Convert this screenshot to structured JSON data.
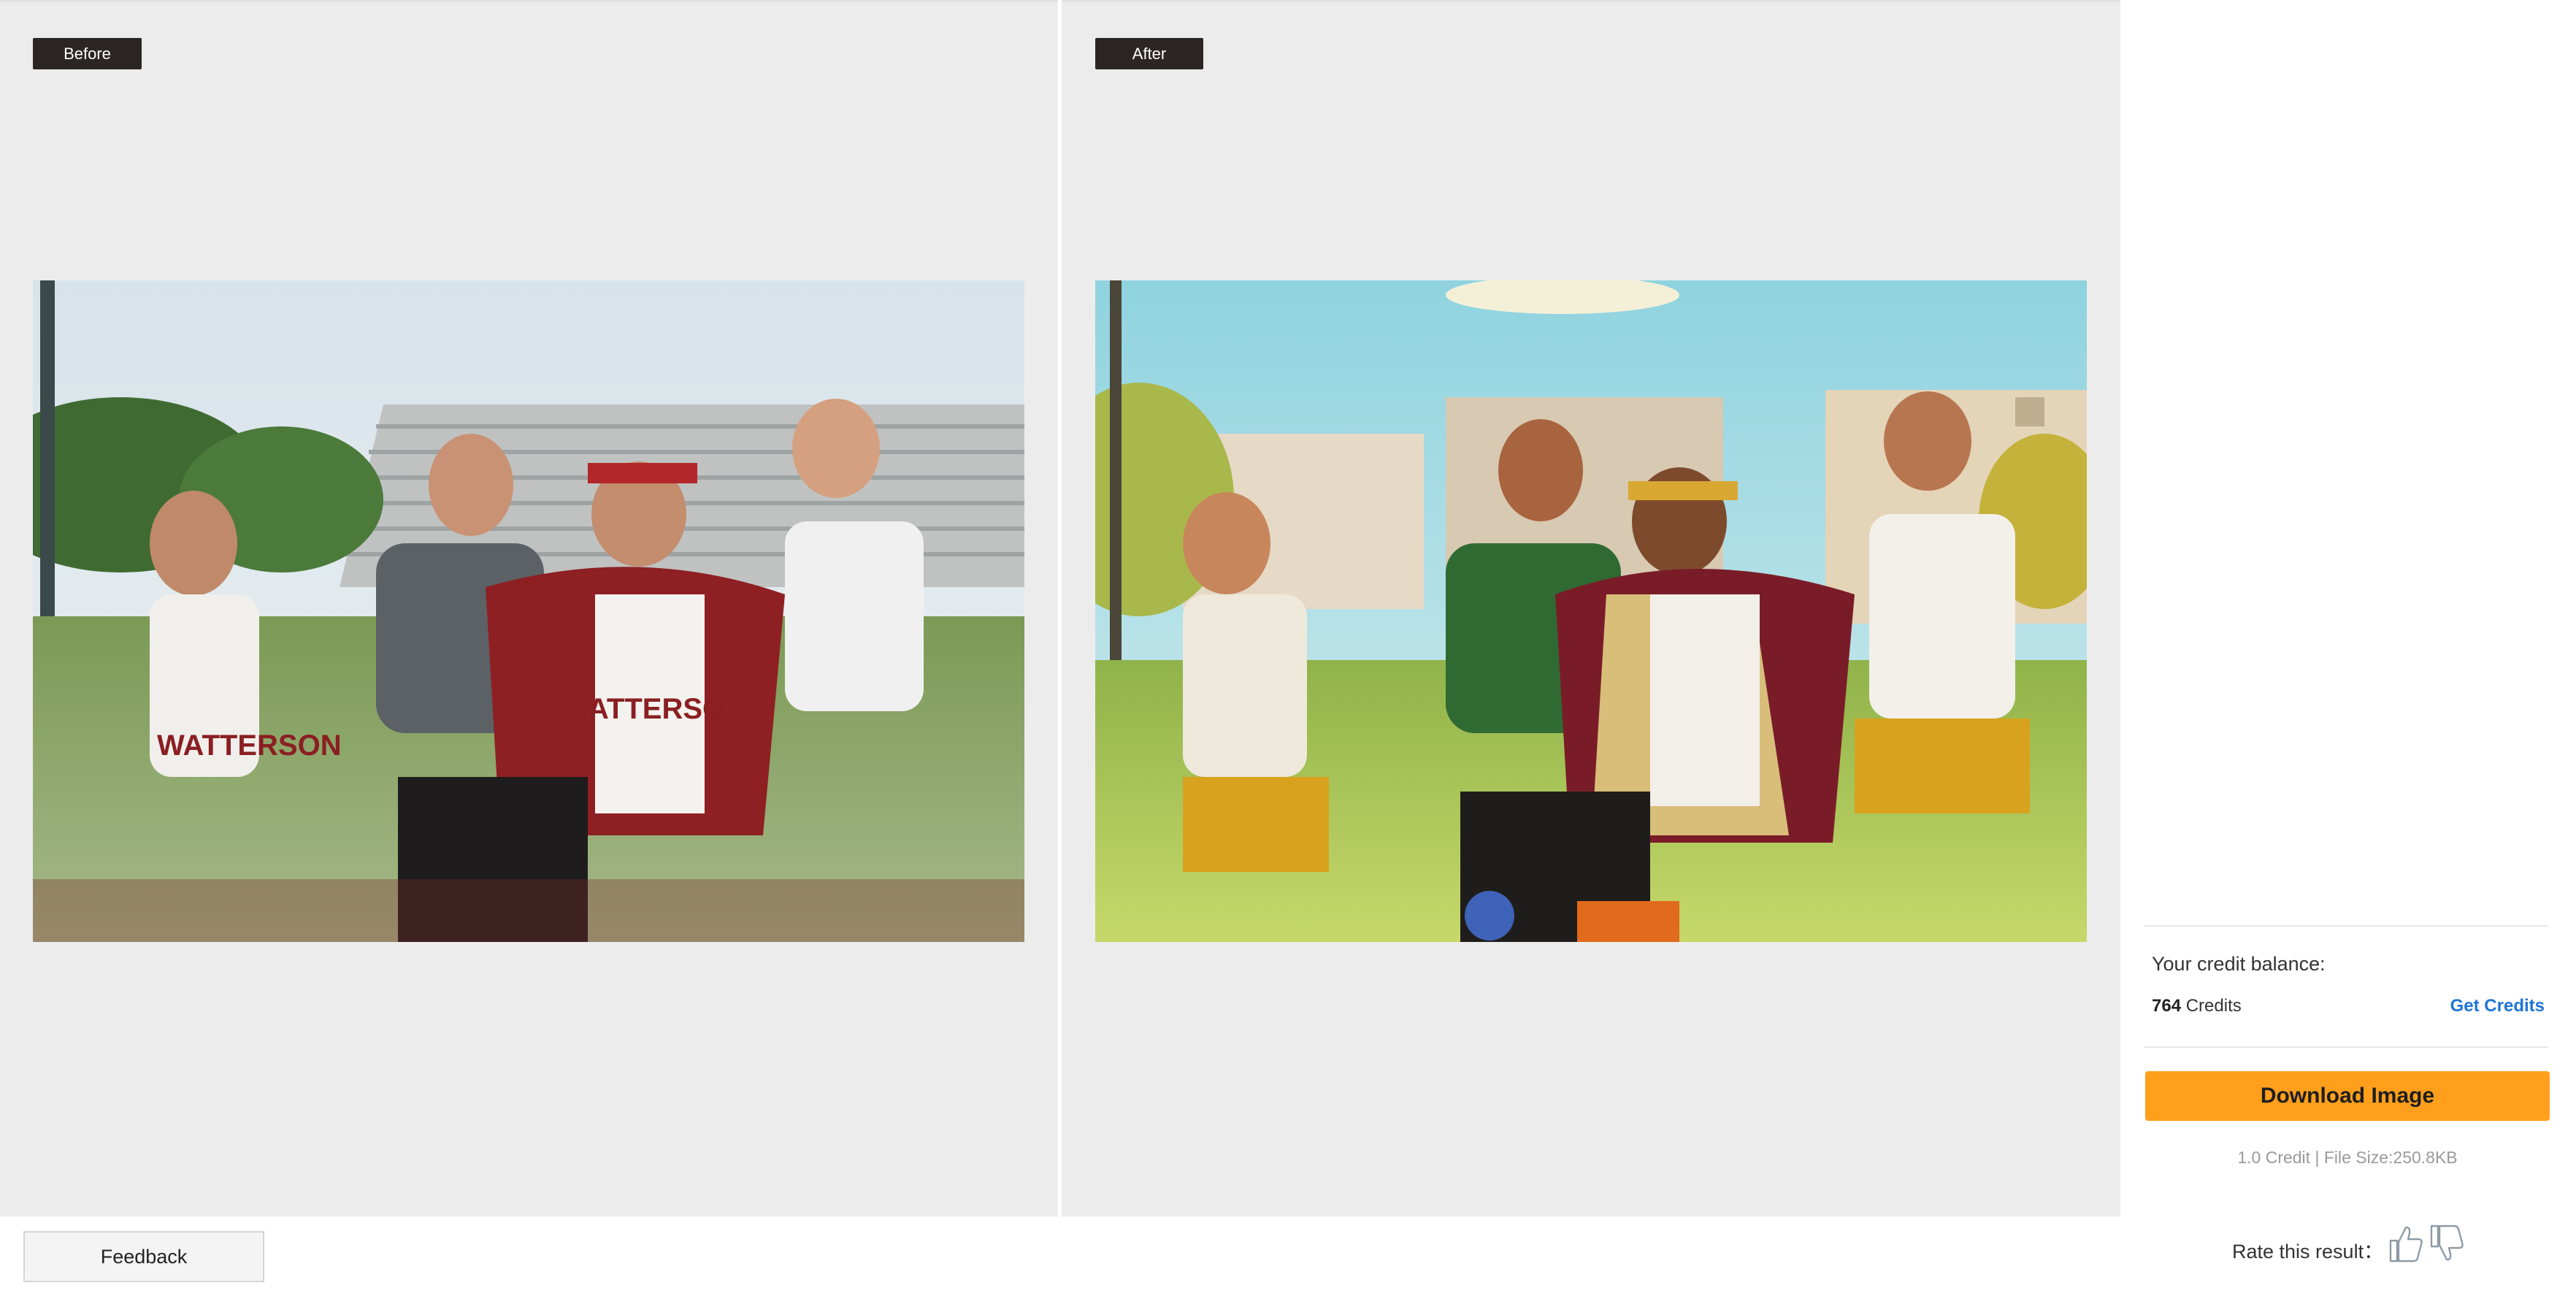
{
  "comparison": {
    "before_label": "Before",
    "after_label": "After"
  },
  "feedback": {
    "label": "Feedback"
  },
  "sidebar": {
    "credit_title": "Your credit balance:",
    "credit_amount": "764",
    "credit_unit": " Credits",
    "get_credits": "Get Credits",
    "download_label": "Download Image",
    "file_info": "1.0 Credit | File Size:250.8KB",
    "rate_label": "Rate this result："
  },
  "icons": {
    "thumb_up": "thumbs-up-icon",
    "thumb_down": "thumbs-down-icon"
  },
  "colors": {
    "accent": "#ff9f1c",
    "link": "#1d74d6",
    "label_bg": "#2b2523",
    "canvas_bg": "#ececec"
  }
}
